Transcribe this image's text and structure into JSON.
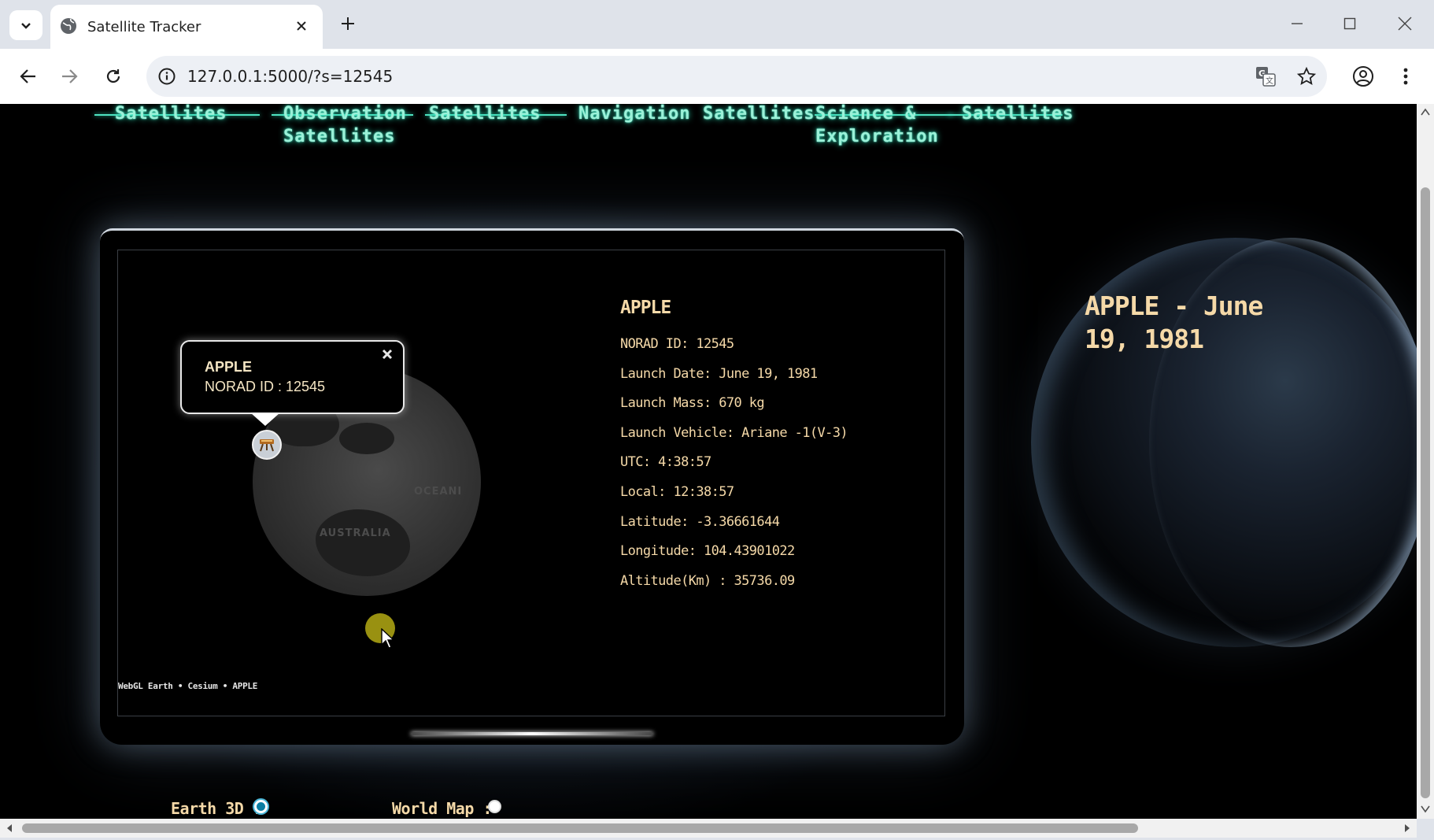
{
  "browser": {
    "tab_title": "Satellite Tracker",
    "url": "127.0.0.1:5000/?s=12545"
  },
  "nav": {
    "items": [
      {
        "label": "Satellites"
      },
      {
        "label": "Observation\nSatellites"
      },
      {
        "label": "Satellites"
      },
      {
        "label": "Navigation"
      },
      {
        "label": "Satellites"
      },
      {
        "label": "Science &\nExploration"
      },
      {
        "label": "Satellites"
      }
    ]
  },
  "side_title": "APPLE - June 19, 1981",
  "popup": {
    "name": "APPLE",
    "norad": "NORAD ID : 12545"
  },
  "globe": {
    "labels": [
      "OCEANI",
      "AUSTRALIA"
    ]
  },
  "credit": "WebGL Earth • Cesium • APPLE",
  "info": {
    "title": "APPLE",
    "lines": [
      "NORAD ID: 12545",
      "Launch Date: June 19, 1981",
      "Launch Mass: 670 kg",
      "Launch Vehicle: Ariane -1(V-3)",
      "UTC: 4:38:57",
      "Local: 12:38:57",
      "Latitude: -3.36661644",
      "Longitude: 104.43901022",
      "Altitude(Km) : 35736.09"
    ]
  },
  "view_toggle": {
    "earth_label": "Earth 3D :",
    "map_label": "World Map :",
    "selected": "Earth 3D"
  },
  "colors": {
    "accent_text": "#f5d9a8",
    "nav_text": "#9bf1d8",
    "radio_selected": "#0b7ea3"
  }
}
